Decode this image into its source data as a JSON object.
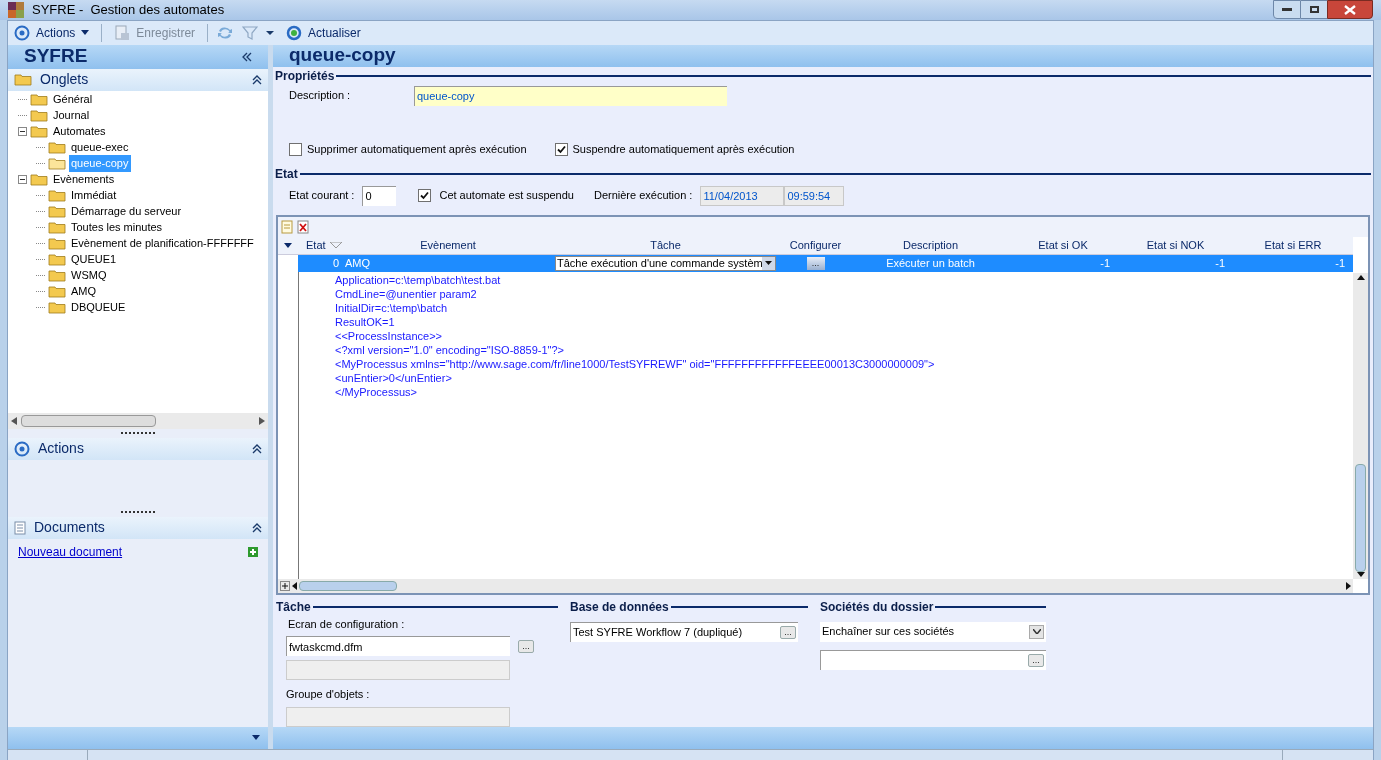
{
  "window": {
    "title": "SYFRE -  Gestion des automates"
  },
  "toolbar": [
    {
      "kind": "menu",
      "label": "Actions",
      "disabled": false
    },
    {
      "kind": "save",
      "label": "Enregistrer",
      "disabled": true
    },
    {
      "kind": "refresh",
      "label": "Actualiser",
      "disabled": false
    }
  ],
  "sidebar": {
    "title": "SYFRE",
    "tabs_panel": {
      "title": "Onglets",
      "tree": [
        {
          "label": "Général",
          "selected": false
        },
        {
          "label": "Journal",
          "selected": false
        },
        {
          "label": "Automates",
          "selected": false,
          "expanded": true,
          "children": [
            {
              "label": "queue-exec",
              "selected": false
            },
            {
              "label": "queue-copy",
              "selected": true
            }
          ]
        },
        {
          "label": "Evènements",
          "selected": false,
          "expanded": true,
          "children": [
            {
              "label": "Immédiat",
              "selected": false
            },
            {
              "label": "Démarrage du serveur",
              "selected": false
            },
            {
              "label": "Toutes les minutes",
              "selected": false
            },
            {
              "label": "Evènement de planification-FFFFFFF",
              "selected": false
            },
            {
              "label": "QUEUE1",
              "selected": false
            },
            {
              "label": "WSMQ",
              "selected": false
            },
            {
              "label": "AMQ",
              "selected": false
            },
            {
              "label": "DBQUEUE",
              "selected": false
            }
          ]
        }
      ]
    },
    "actions_panel": {
      "title": "Actions"
    },
    "documents_panel": {
      "title": "Documents",
      "link": "Nouveau document"
    }
  },
  "main": {
    "title": "queue-copy",
    "properties": {
      "title": "Propriétés",
      "description_label": "Description :",
      "description_value": "queue-copy",
      "options": [
        {
          "label": "Supprimer automatiquement après exécution",
          "checked": false
        },
        {
          "label": "Suspendre automatiquement après exécution",
          "checked": true
        }
      ]
    },
    "state": {
      "title": "Etat",
      "current_label": "Etat courant :",
      "current_value": "0",
      "suspended": {
        "label": "Cet automate est suspendu",
        "checked": true
      },
      "last_run_label": "Dernière exécution :",
      "last_run_date": "11/04/2013",
      "last_run_time": "09:59:54"
    },
    "grid": {
      "columns": [
        "Etat",
        "Evènement",
        "Tâche",
        "Configurer",
        "Description",
        "Etat si OK",
        "Etat si NOK",
        "Etat si ERR"
      ],
      "rows": [
        {
          "etat": "0",
          "evenement": "AMQ",
          "tache": "Tâche exécution d'une commande systèm",
          "configurer": "...",
          "description": "Exécuter un batch",
          "ok": "-1",
          "nok": "-1",
          "err": "-1",
          "selected": true
        }
      ],
      "detail_lines": [
        "Application=c:\\temp\\batch\\test.bat",
        "CmdLine=@unentier param2",
        "InitialDir=c:\\temp\\batch",
        "ResultOK=1",
        "<<ProcessInstance>>",
        "<?xml version=\"1.0\" encoding=\"ISO-8859-1\"?>",
        "<MyProcessus xmlns=\"http://www.sage.com/fr/line1000/TestSYFREWF\" oid=\"FFFFFFFFFFFFEEEE00013C3000000009\">",
        "<unEntier>0</unEntier>",
        "</MyProcessus>"
      ]
    },
    "task": {
      "title": "Tâche",
      "config_label": "Ecran de configuration :",
      "config_value": "fwtaskcmd.dfm",
      "browse": "...",
      "group_label": "Groupe d'objets :"
    },
    "database": {
      "title": "Base de données",
      "value": "Test SYFRE Workflow 7 (dupliqué)",
      "browse": "..."
    },
    "companies": {
      "title": "Sociétés du dossier",
      "mode": "Enchaîner sur ces sociétés",
      "browse": "..."
    }
  }
}
